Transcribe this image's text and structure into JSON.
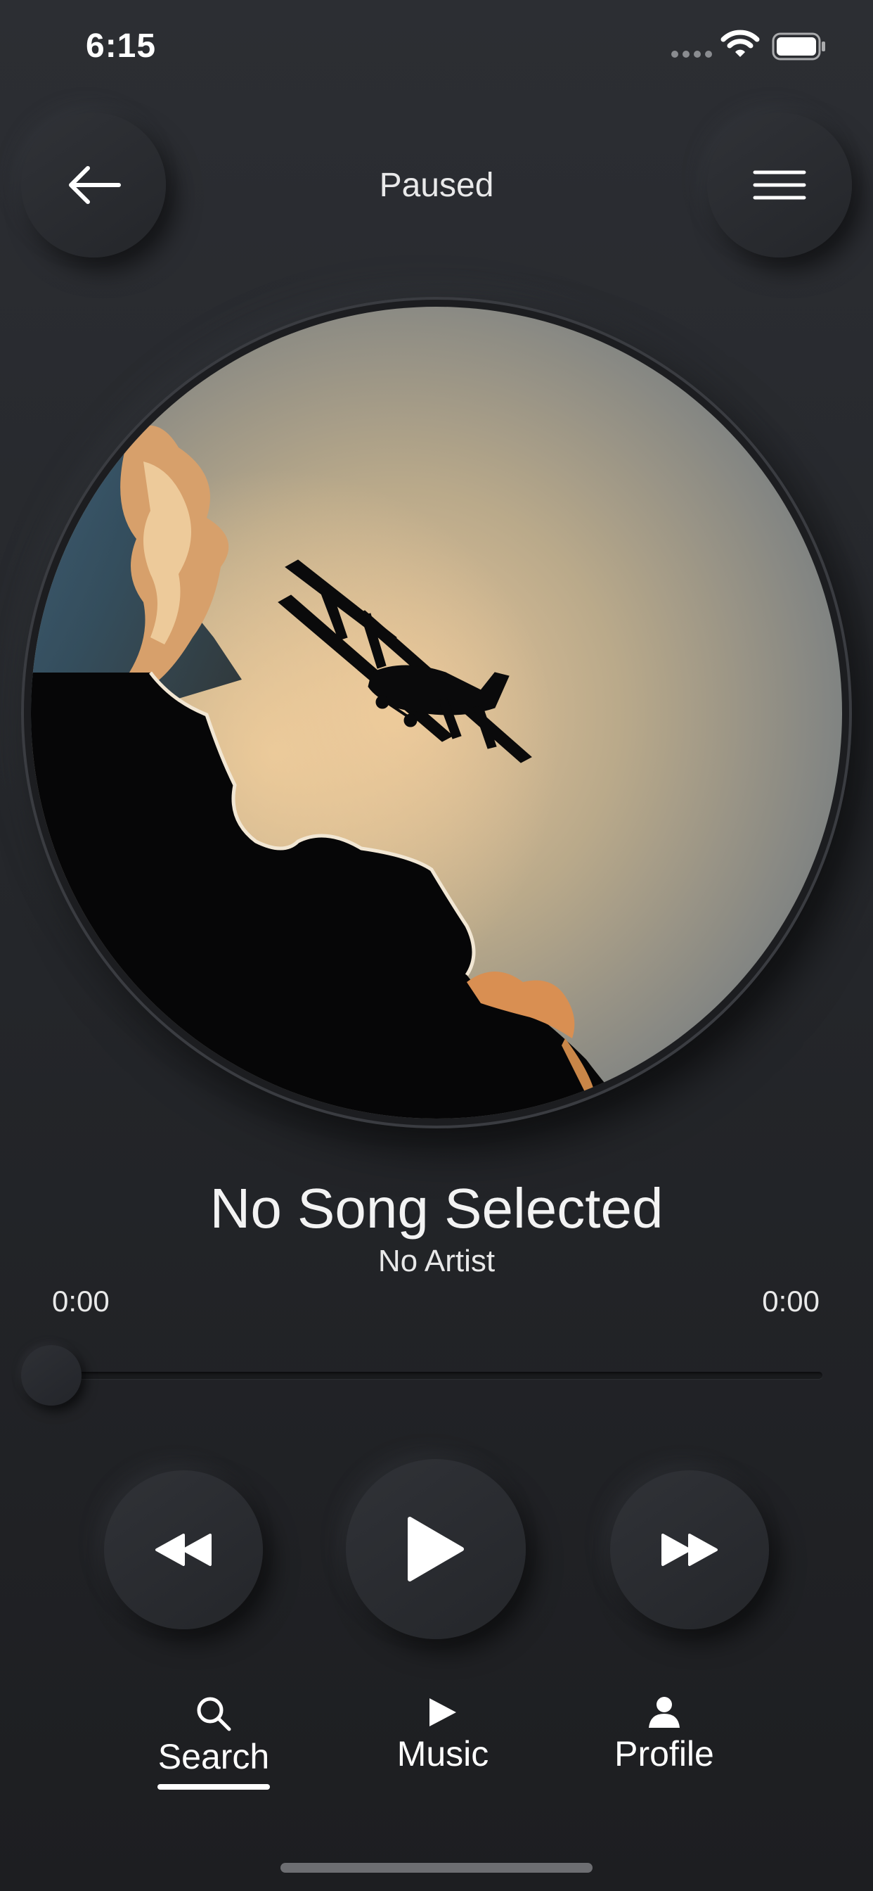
{
  "status_bar": {
    "time": "6:15"
  },
  "header": {
    "title": "Paused",
    "back_icon": "arrow-left-icon",
    "menu_icon": "hamburger-menu-icon"
  },
  "player": {
    "song_title": "No Song Selected",
    "artist": "No Artist",
    "elapsed": "0:00",
    "duration": "0:00",
    "progress": 0
  },
  "controls": {
    "rewind_icon": "rewind-icon",
    "play_icon": "play-icon",
    "fast_forward_icon": "fast-forward-icon"
  },
  "nav": {
    "items": [
      {
        "label": "Search",
        "icon": "search-icon",
        "active": true
      },
      {
        "label": "Music",
        "icon": "play-icon",
        "active": false
      },
      {
        "label": "Profile",
        "icon": "person-icon",
        "active": false
      }
    ]
  },
  "colors": {
    "background": "#25272b",
    "text": "#ffffff"
  }
}
